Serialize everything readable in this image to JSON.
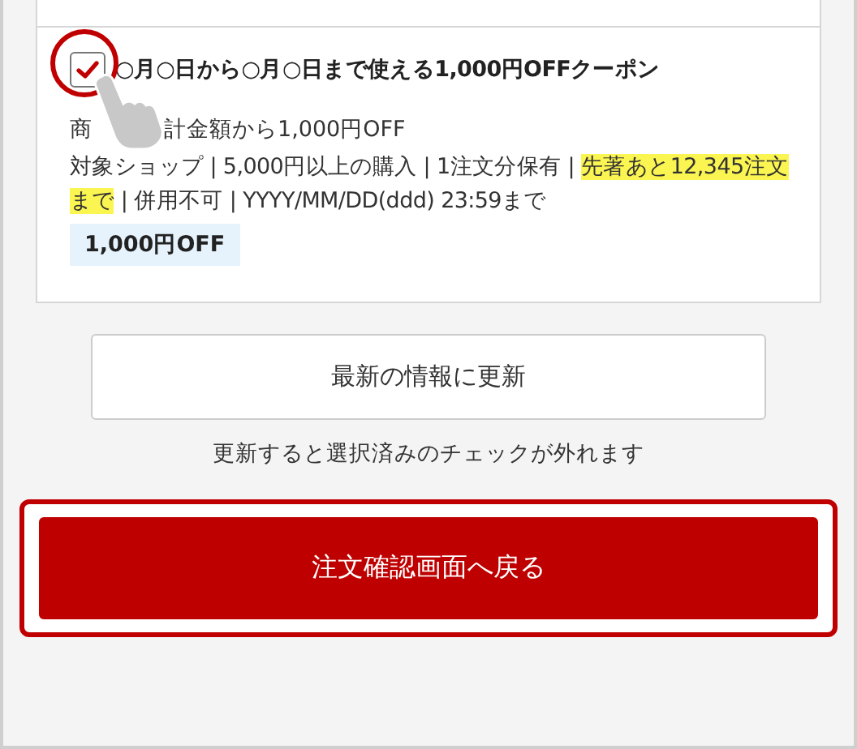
{
  "coupon": {
    "checked": true,
    "title": "○月○日から○月○日まで使える1,000円OFFクーポン",
    "discount_parts": [
      "商",
      "計金額から1,000円OFF"
    ],
    "conditions": [
      {
        "text": "対象ショップ | 5,000円以上の購入 | 1注文分保有 | ",
        "highlight": false
      },
      {
        "text": "先著あと12,345注文まで",
        "highlight": true
      },
      {
        "text": " | 併用不可 | YYYY/MM/DD(ddd) 23:59まで",
        "highlight": false
      }
    ],
    "badge": "1,000円OFF"
  },
  "refresh_button": "最新の情報に更新",
  "refresh_note": "更新すると選択済みのチェックが外れます",
  "back_button": "注文確認画面へ戻る"
}
